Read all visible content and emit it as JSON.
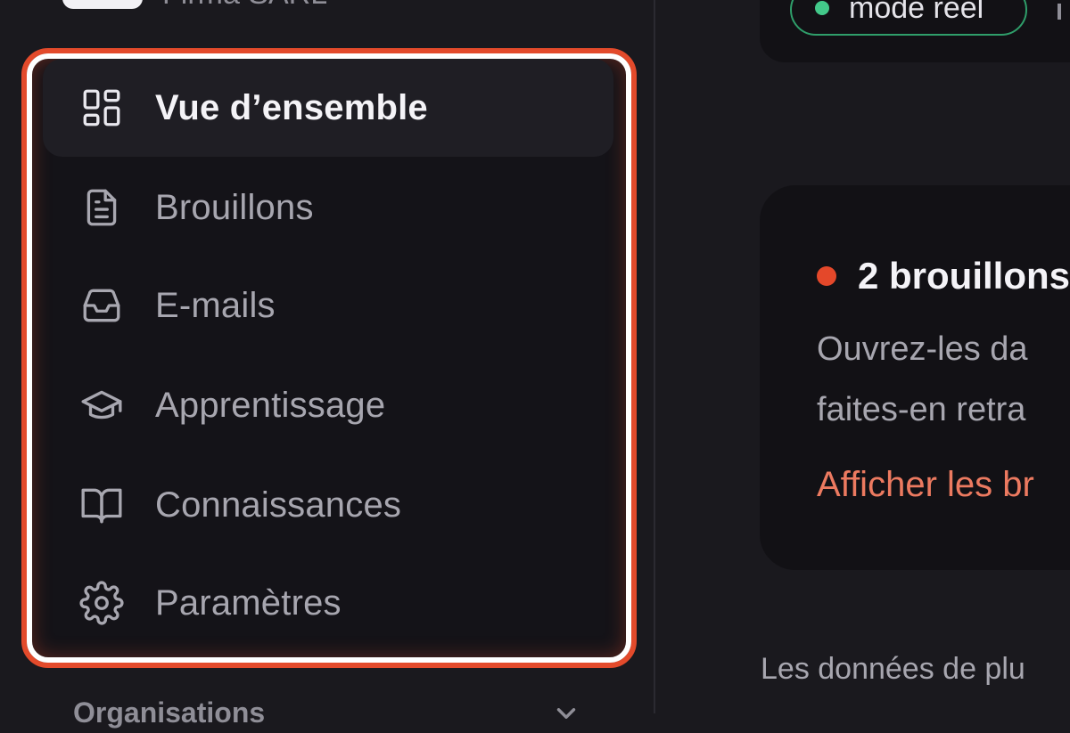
{
  "brand": {
    "name": "Firma SARL"
  },
  "sidebar": {
    "items": [
      {
        "label": "Vue d’ensemble",
        "icon": "dashboard-grid-icon",
        "active": true
      },
      {
        "label": "Brouillons",
        "icon": "document-icon",
        "active": false
      },
      {
        "label": "E-mails",
        "icon": "inbox-tray-icon",
        "active": false
      },
      {
        "label": "Apprentissage",
        "icon": "graduation-cap-icon",
        "active": false
      },
      {
        "label": "Connaissances",
        "icon": "open-book-icon",
        "active": false
      },
      {
        "label": "Paramètres",
        "icon": "gear-icon",
        "active": false
      }
    ],
    "section_label": "Organisations"
  },
  "header": {
    "mode_label": "mode réel"
  },
  "draft_card": {
    "title": "2 brouillons",
    "body_line_1": "Ouvrez-les da",
    "body_line_2": "faites-en retra",
    "link_label": "Afficher les br"
  },
  "footer": {
    "note": "Les données de plu"
  },
  "colors": {
    "accent": "#e4482a",
    "live_green": "#43c98a",
    "link": "#ec7a60",
    "background": "#1a191e"
  }
}
